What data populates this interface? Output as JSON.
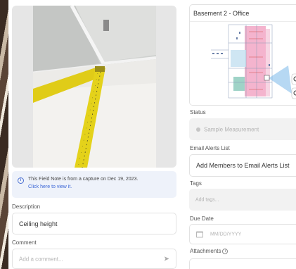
{
  "capture": {
    "note_text": "This Field Note is from a capture on Dec 19, 2023.",
    "note_link": "Click here to view it."
  },
  "description": {
    "label": "Description",
    "value": "Ceiling height"
  },
  "comment": {
    "label": "Comment",
    "placeholder": "Add a comment..."
  },
  "plan": {
    "title": "Basement 2 - Office"
  },
  "status": {
    "label": "Status",
    "value": "Sample Measurement"
  },
  "email_alerts": {
    "label": "Email Alerts List",
    "button": "Add Members to Email Alerts List"
  },
  "tags": {
    "label": "Tags",
    "placeholder": "Add tags..."
  },
  "due_date": {
    "label": "Due Date",
    "placeholder": "MM/DD/YYYY"
  },
  "attachments": {
    "label": "Attachments"
  },
  "icons": {
    "info": "info-icon",
    "send": "send-icon",
    "calendar": "calendar-icon",
    "status_dot": "status-dot-icon"
  },
  "colors": {
    "link": "#3b66d6",
    "note_bg": "#eef2fa",
    "plan_highlight": "#f2a7c6",
    "tape": "#e4d21a"
  }
}
